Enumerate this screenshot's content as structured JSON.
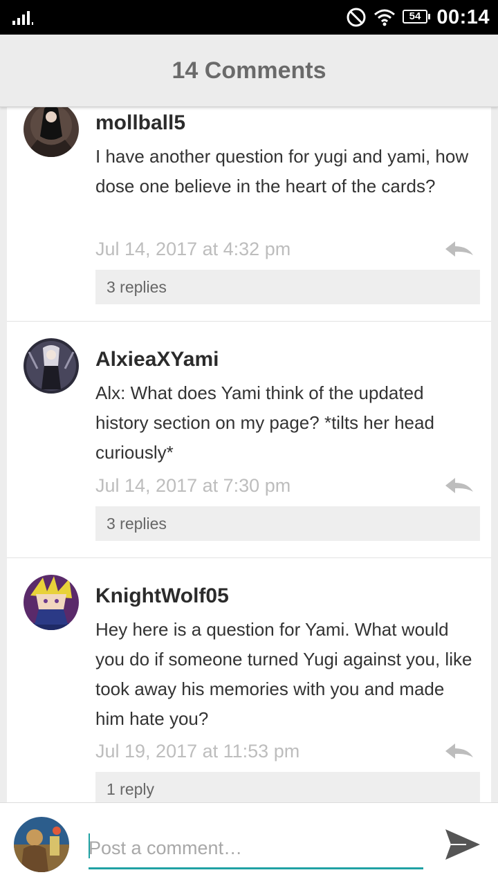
{
  "status_bar": {
    "battery": "54",
    "time": "00:14"
  },
  "header": {
    "title": "14 Comments"
  },
  "comments": [
    {
      "username": "mollball5",
      "text": "I have another question for yugi and yami, how dose one  believe in the heart of the cards?",
      "date": "Jul 14, 2017 at 4:32 pm",
      "replies": "3 replies"
    },
    {
      "username": "AlxieaXYami",
      "text": "Alx: What does Yami think of the updated history section on my page? *tilts her head curiously*",
      "date": "Jul 14, 2017 at 7:30 pm",
      "replies": "3 replies"
    },
    {
      "username": "KnightWolf05",
      "text": "Hey here is a question for Yami. What would you do if someone turned Yugi against you, like took away his memories with you and made him hate you?",
      "date": "Jul 19, 2017 at 11:53 pm",
      "replies": "1 reply"
    }
  ],
  "composer": {
    "placeholder": "Post a comment…"
  },
  "icons": {
    "signal": "signal-icon",
    "dnd": "do-not-disturb-icon",
    "wifi": "wifi-icon",
    "battery": "battery-icon",
    "reply": "reply-arrow-icon",
    "send": "send-icon"
  },
  "colors": {
    "accent": "#1fa1a3",
    "header_bg": "#ececec",
    "date_text": "#bdbdbd"
  }
}
